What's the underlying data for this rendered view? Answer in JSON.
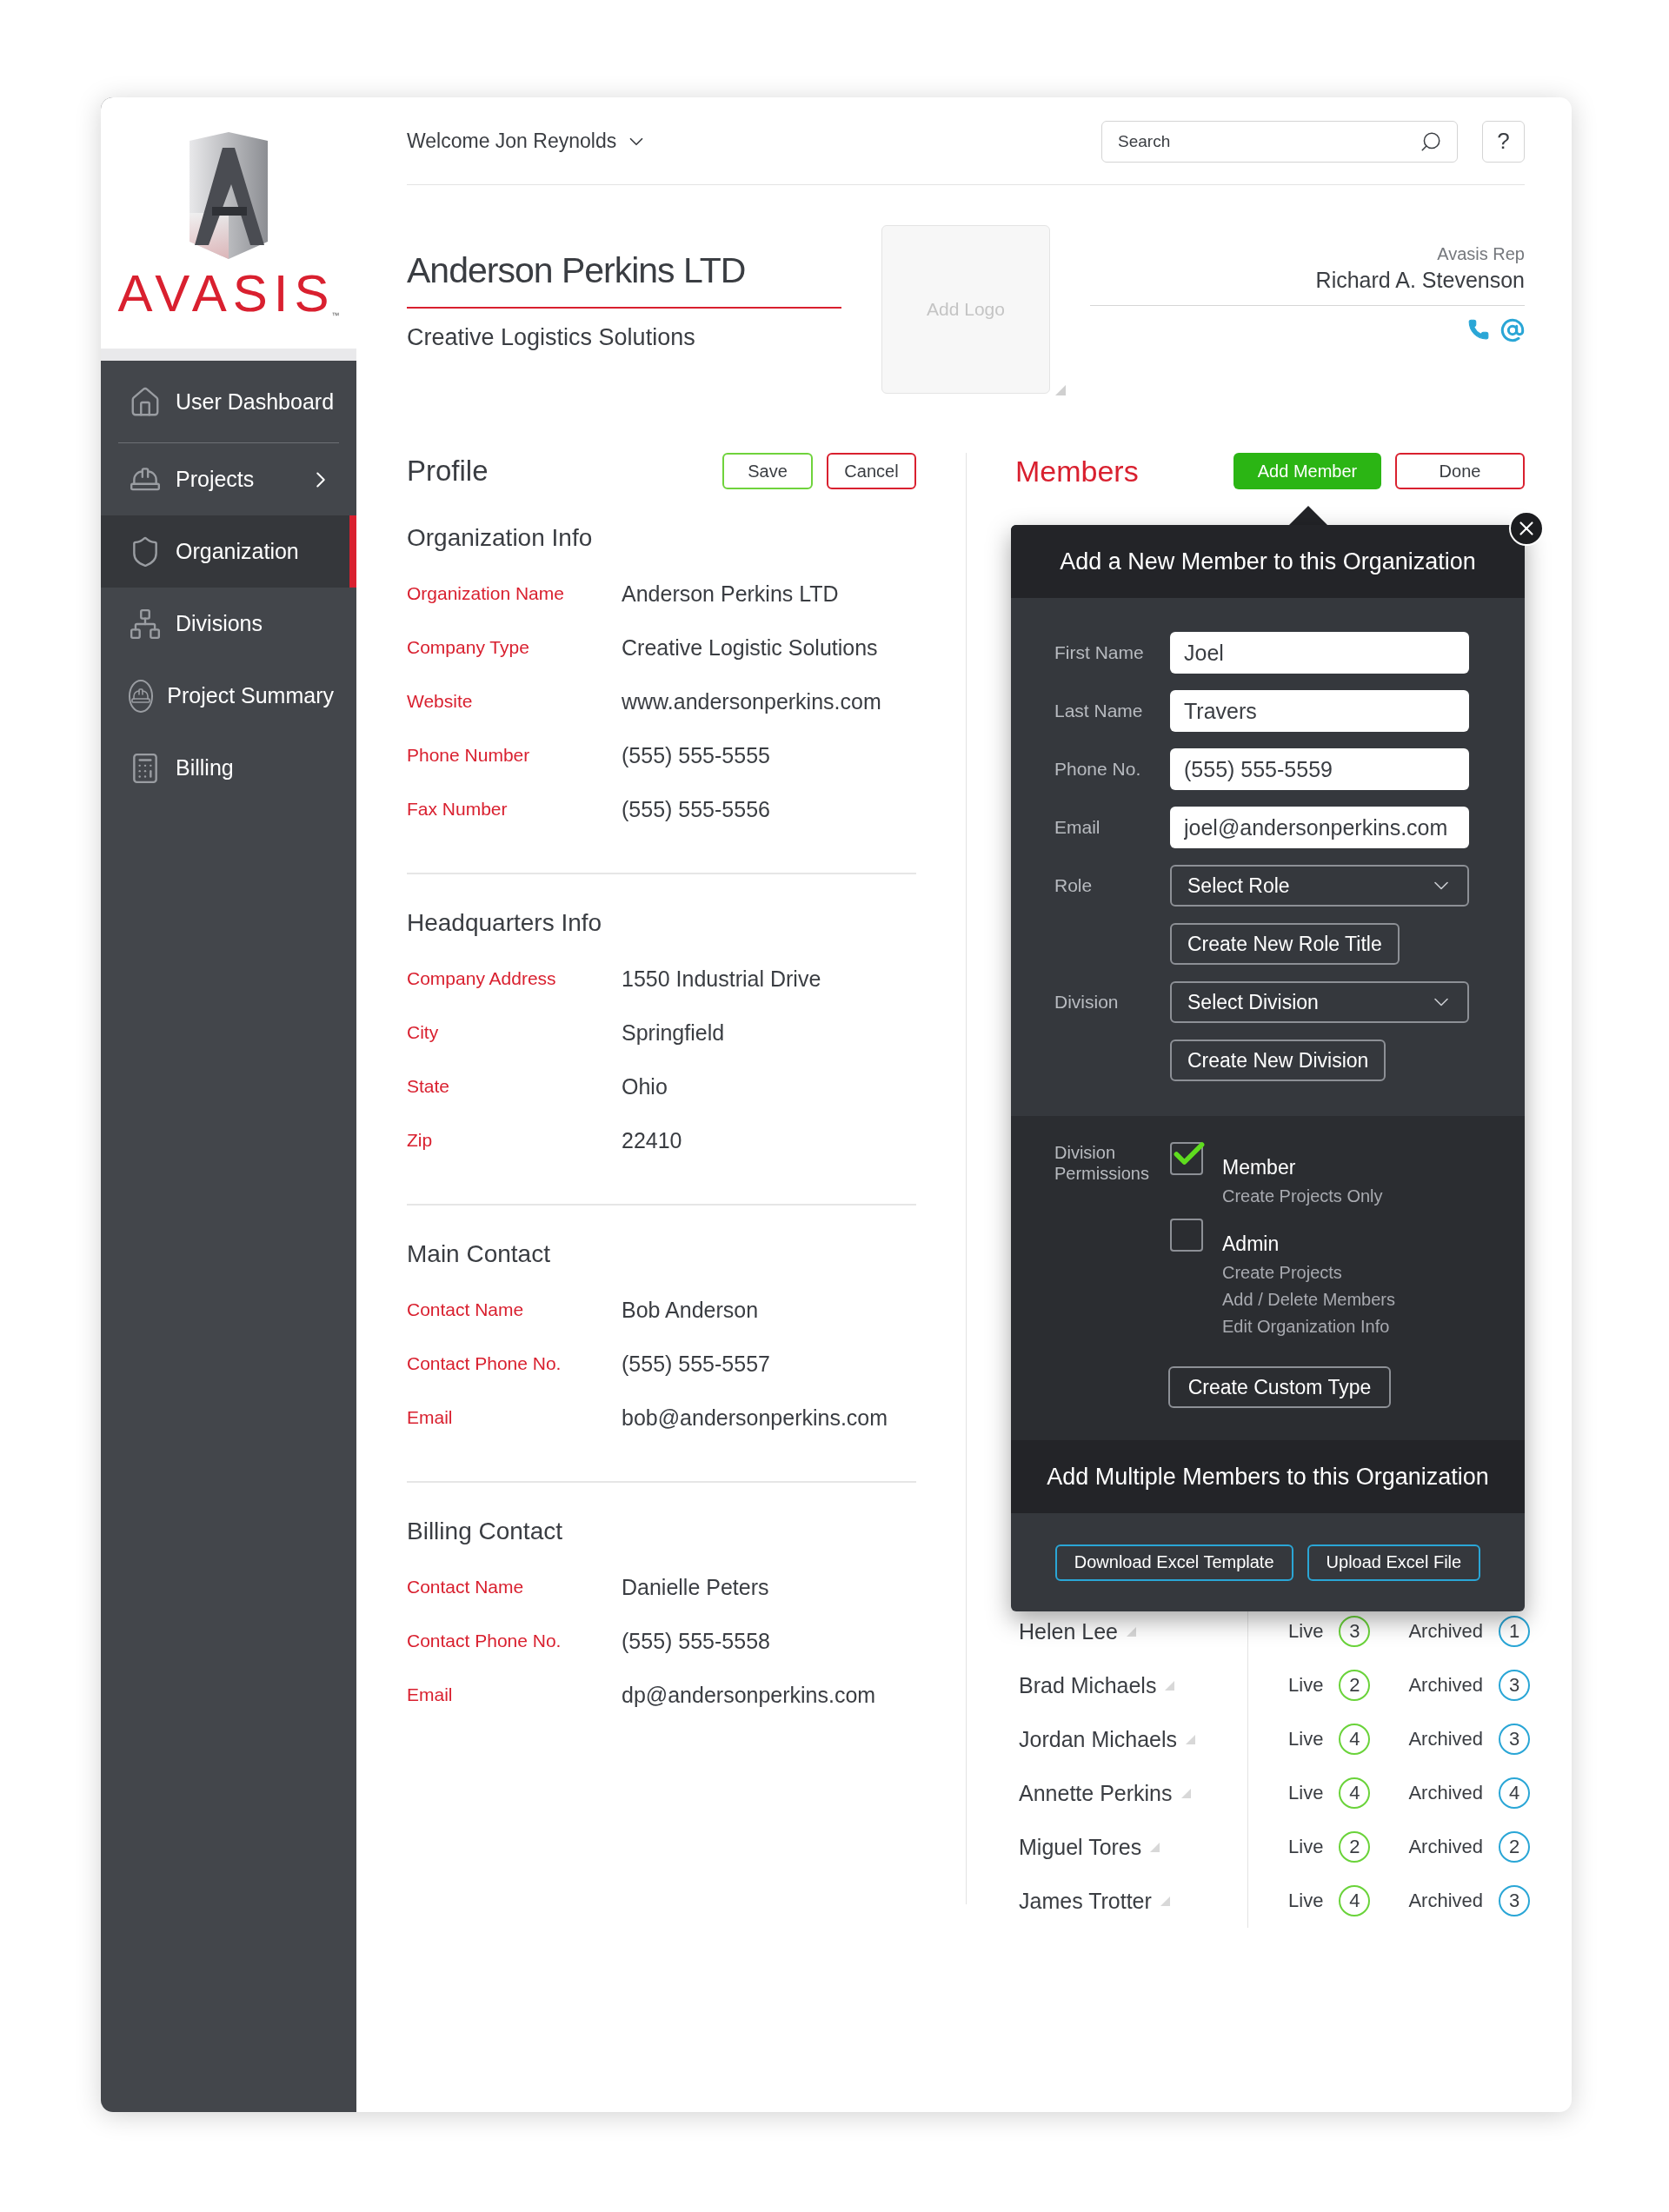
{
  "brand": {
    "name": "AVASIS",
    "trademark": "™"
  },
  "sidebar": {
    "items": [
      {
        "label": "User Dashboard",
        "selected": false,
        "expandable": false,
        "divider_after": true
      },
      {
        "label": "Projects",
        "selected": false,
        "expandable": true,
        "divider_after": false
      },
      {
        "label": "Organization",
        "selected": true,
        "expandable": false,
        "divider_after": false
      },
      {
        "label": "Divisions",
        "selected": false,
        "expandable": false,
        "divider_after": false
      },
      {
        "label": "Project Summary",
        "selected": false,
        "expandable": false,
        "divider_after": false
      },
      {
        "label": "Billing",
        "selected": false,
        "expandable": false,
        "divider_after": false
      }
    ]
  },
  "header": {
    "welcome": "Welcome Jon Reynolds",
    "search": {
      "placeholder": "Search"
    },
    "help": "?"
  },
  "company": {
    "name": "Anderson Perkins LTD",
    "subtitle": "Creative Logistics Solutions",
    "logo_placeholder": "Add Logo",
    "rep_label": "Avasis Rep",
    "rep_name": "Richard A. Stevenson"
  },
  "profile": {
    "title": "Profile",
    "save": "Save",
    "cancel": "Cancel",
    "sections": [
      {
        "title": "Organization Info",
        "fields": [
          {
            "label": "Organization Name",
            "value": "Anderson Perkins LTD"
          },
          {
            "label": "Company Type",
            "value": "Creative Logistic Solutions"
          },
          {
            "label": "Website",
            "value": "www.andersonperkins.com"
          },
          {
            "label": "Phone Number",
            "value": "(555) 555-5555"
          },
          {
            "label": "Fax Number",
            "value": "(555) 555-5556"
          }
        ]
      },
      {
        "title": "Headquarters Info",
        "fields": [
          {
            "label": "Company Address",
            "value": "1550 Industrial Drive"
          },
          {
            "label": "City",
            "value": "Springfield"
          },
          {
            "label": "State",
            "value": "Ohio"
          },
          {
            "label": "Zip",
            "value": "22410"
          }
        ]
      },
      {
        "title": "Main Contact",
        "fields": [
          {
            "label": "Contact Name",
            "value": "Bob Anderson"
          },
          {
            "label": "Contact Phone No.",
            "value": "(555) 555-5557"
          },
          {
            "label": "Email",
            "value": "bob@andersonperkins.com"
          }
        ]
      },
      {
        "title": "Billing Contact",
        "fields": [
          {
            "label": "Contact Name",
            "value": "Danielle Peters"
          },
          {
            "label": "Contact Phone No.",
            "value": "(555) 555-5558"
          },
          {
            "label": "Email",
            "value": "dp@andersonperkins.com"
          }
        ]
      }
    ]
  },
  "members": {
    "title": "Members",
    "add_button": "Add Member",
    "done_button": "Done",
    "list": [
      {
        "name": "Helen Lee",
        "live_label": "Live",
        "live_count": "3",
        "archived_label": "Archived",
        "archived_count": "1"
      },
      {
        "name": "Brad Michaels",
        "live_label": "Live",
        "live_count": "2",
        "archived_label": "Archived",
        "archived_count": "3"
      },
      {
        "name": "Jordan Michaels",
        "live_label": "Live",
        "live_count": "4",
        "archived_label": "Archived",
        "archived_count": "3"
      },
      {
        "name": "Annette Perkins",
        "live_label": "Live",
        "live_count": "4",
        "archived_label": "Archived",
        "archived_count": "4"
      },
      {
        "name": "Miguel Tores",
        "live_label": "Live",
        "live_count": "2",
        "archived_label": "Archived",
        "archived_count": "2"
      },
      {
        "name": "James Trotter",
        "live_label": "Live",
        "live_count": "4",
        "archived_label": "Archived",
        "archived_count": "3"
      }
    ]
  },
  "dialog": {
    "title": "Add a New Member to this Organization",
    "rows": [
      {
        "kind": "input",
        "label": "First Name",
        "value": "Joel"
      },
      {
        "kind": "input",
        "label": "Last Name",
        "value": "Travers"
      },
      {
        "kind": "input",
        "label": "Phone No.",
        "value": "(555) 555-5559"
      },
      {
        "kind": "input",
        "label": "Email",
        "value": "joel@andersonperkins.com"
      },
      {
        "kind": "select",
        "label": "Role",
        "value": "Select Role"
      },
      {
        "kind": "button",
        "text": "Create New Role Title"
      },
      {
        "kind": "select",
        "label": "Division",
        "value": "Select Division"
      },
      {
        "kind": "button",
        "text": "Create New Division"
      }
    ],
    "permissions": {
      "label": "Division Permissions",
      "options": [
        {
          "title": "Member",
          "details": [
            "Create Projects Only"
          ],
          "checked": true
        },
        {
          "title": "Admin",
          "details": [
            "Create Projects",
            "Add / Delete Members",
            "Edit Organization Info"
          ],
          "checked": false
        }
      ],
      "custom_button": "Create Custom Type"
    },
    "bulk": {
      "title": "Add Multiple Members to this Organization",
      "buttons": [
        "Download Excel Template",
        "Upload Excel File"
      ]
    }
  }
}
